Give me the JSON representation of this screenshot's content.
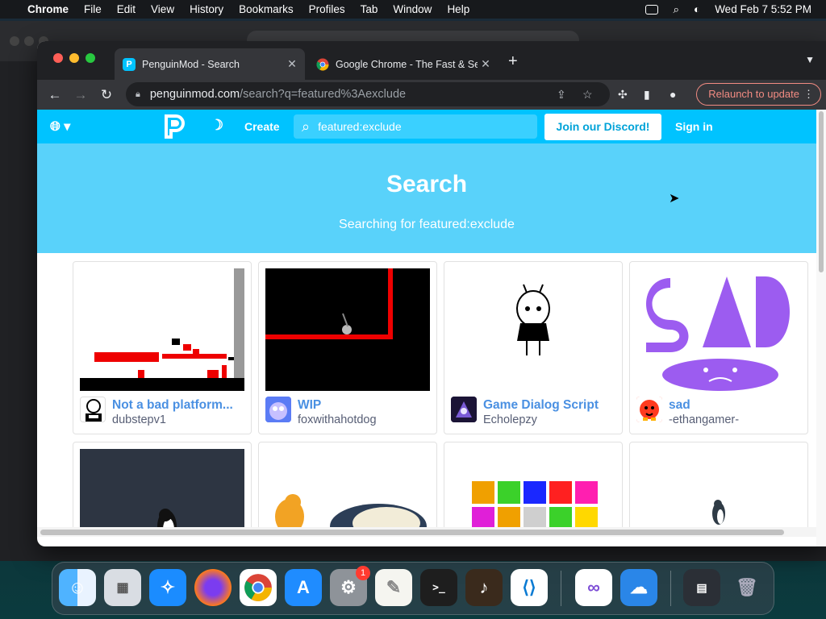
{
  "menubar": {
    "app": "Chrome",
    "items": [
      "File",
      "Edit",
      "View",
      "History",
      "Bookmarks",
      "Profiles",
      "Tab",
      "Window",
      "Help"
    ],
    "clock": "Wed Feb 7  5:52 PM"
  },
  "browser": {
    "tabs": [
      {
        "title": "PenguinMod - Search",
        "favicon": "penguinmod-icon"
      },
      {
        "title": "Google Chrome - The Fast & Secure",
        "favicon": "chrome-icon"
      }
    ],
    "url_host": "penguinmod.com",
    "url_path": "/search?q=featured%3Aexclude",
    "relaunch_label": "Relaunch to update"
  },
  "site": {
    "create_label": "Create",
    "search_value": "featured:exclude",
    "discord_label": "Join our Discord!",
    "signin_label": "Sign in",
    "banner_title": "Search",
    "banner_subtitle": "Searching for featured:exclude"
  },
  "projects": [
    {
      "title": "Not a bad platform...",
      "author": "dubstepv1"
    },
    {
      "title": "WIP",
      "author": "foxwithahotdog"
    },
    {
      "title": "Game Dialog Script",
      "author": "Echolepzy"
    },
    {
      "title": "sad",
      "author": "-ethangamer-"
    }
  ],
  "dock": {
    "items": [
      "finder-icon",
      "launchpad-icon",
      "safari-icon",
      "firefox-icon",
      "chrome-icon",
      "app-store-icon",
      "system-settings-icon",
      "textedit-icon",
      "terminal-icon",
      "garageband-icon",
      "vscode-icon",
      "visual-studio-icon",
      "weather-icon",
      "downloads-stack-icon",
      "trash-icon"
    ],
    "settings_badge": "1"
  },
  "colors": {
    "site_header": "#00c3ff",
    "banner": "#59d2fa",
    "link": "#4a90e2"
  }
}
